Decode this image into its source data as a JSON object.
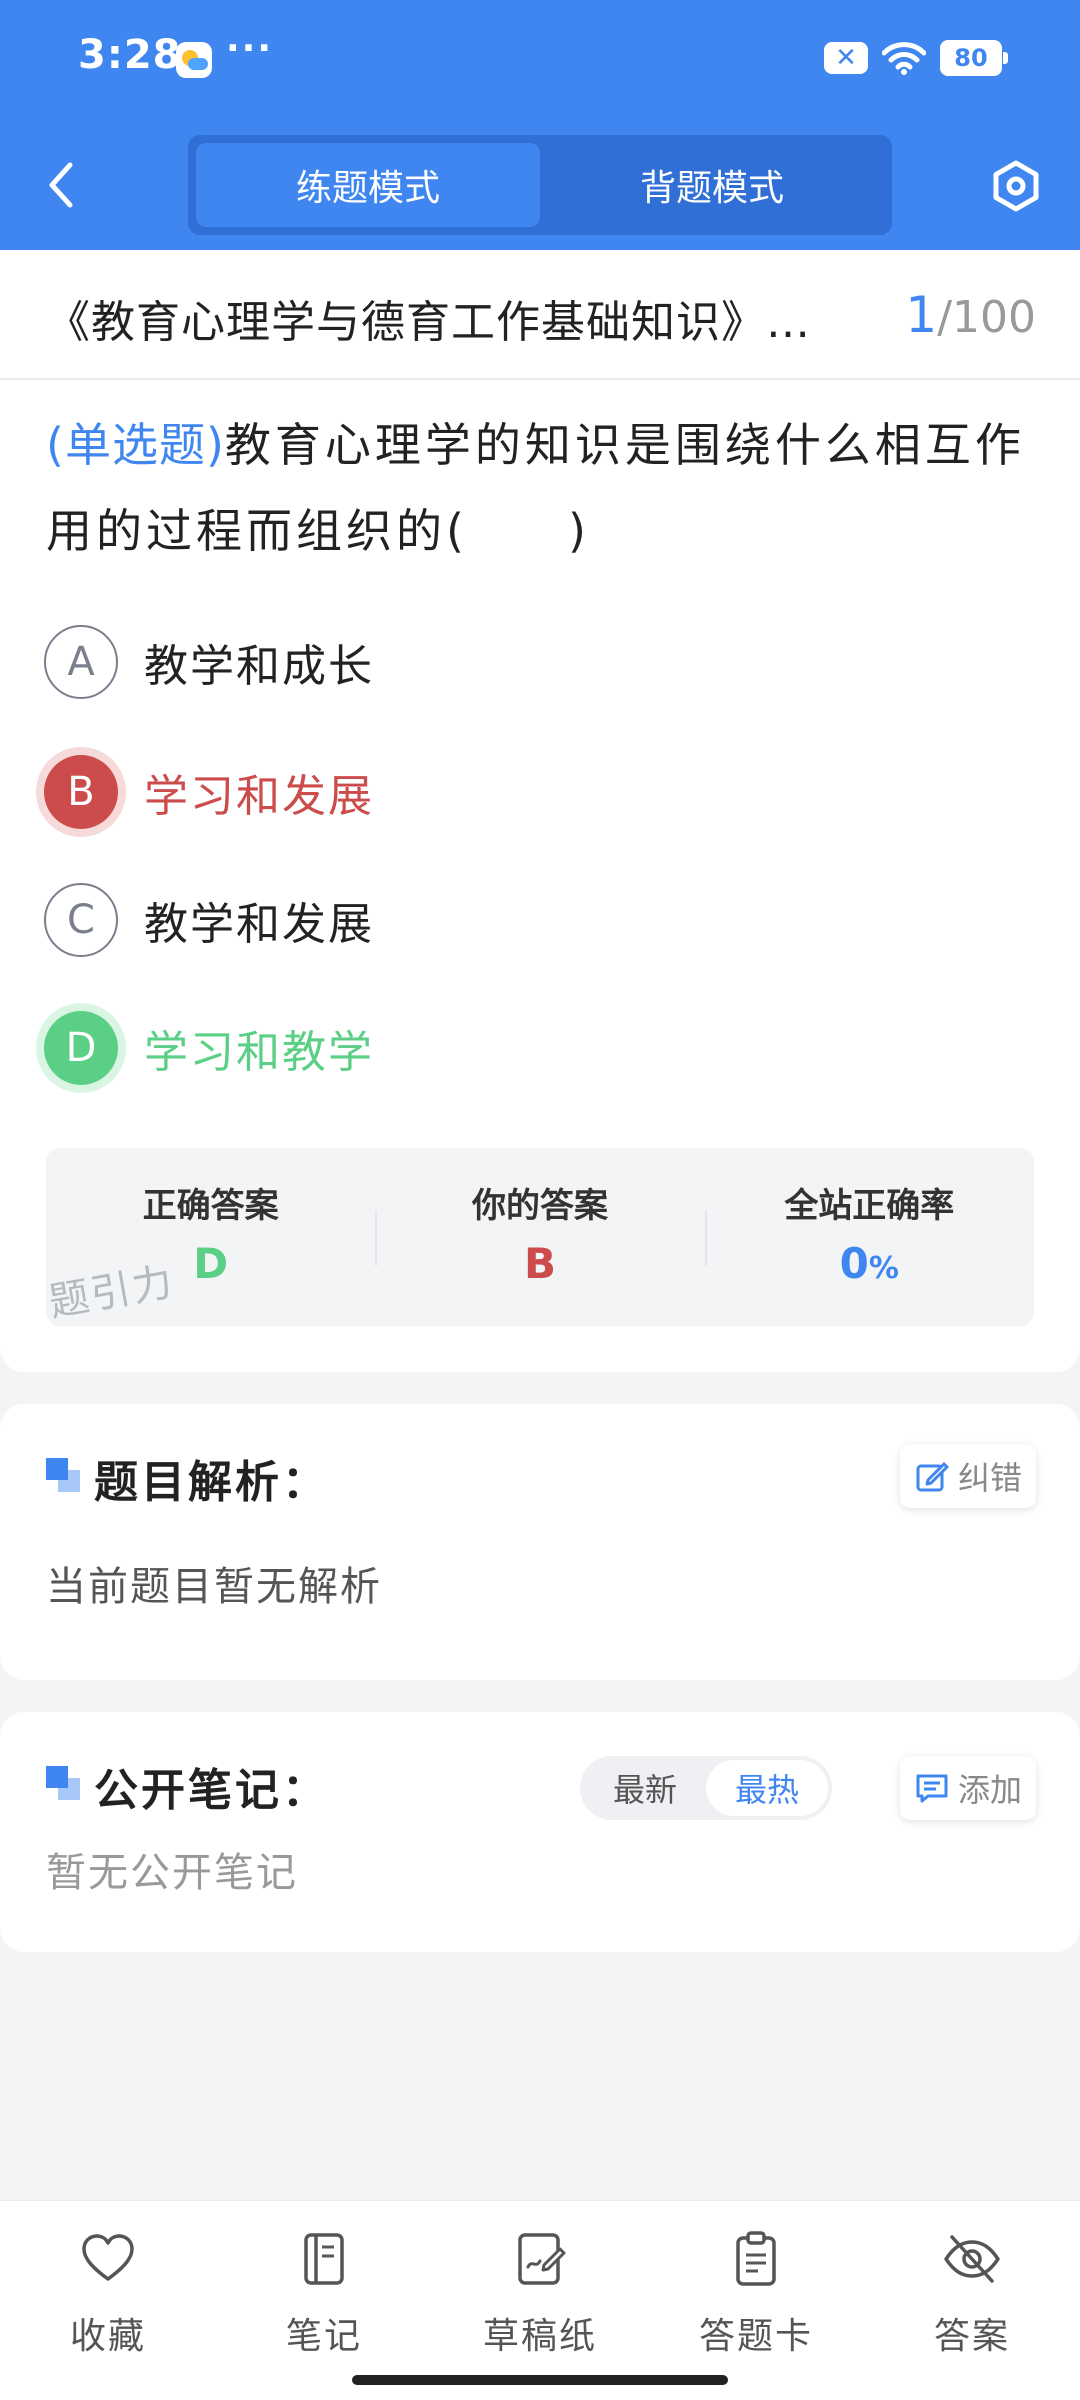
{
  "status_bar": {
    "time": "3:28",
    "dots": "···",
    "sim_badge": "✕",
    "battery": "80"
  },
  "header": {
    "modes": [
      "练题模式",
      "背题模式"
    ],
    "active_mode": 0
  },
  "title_bar": {
    "title": "《教育心理学与德育工作基础知识》…",
    "current": "1",
    "total": "/100"
  },
  "question": {
    "type": "(单选题)",
    "text": "教育心理学的知识是围绕什么相互作用的过程而组织的(　　)",
    "options": [
      {
        "letter": "A",
        "text": "教学和成长",
        "state": "normal"
      },
      {
        "letter": "B",
        "text": "学习和发展",
        "state": "wrong"
      },
      {
        "letter": "C",
        "text": "教学和发展",
        "state": "normal"
      },
      {
        "letter": "D",
        "text": "学习和教学",
        "state": "correct"
      }
    ]
  },
  "answer_summary": {
    "correct_label": "正确答案",
    "correct_value": "D",
    "yours_label": "你的答案",
    "yours_value": "B",
    "rate_label": "全站正确率",
    "rate_value": "0",
    "rate_unit": "%",
    "watermark": "题引力"
  },
  "analysis": {
    "title": "题目解析：",
    "body": "当前题目暂无解析",
    "report_label": "纠错"
  },
  "notes": {
    "title": "公开笔记：",
    "sort_options": [
      "最新",
      "最热"
    ],
    "active_sort": 1,
    "add_label": "添加",
    "empty_text": "暂无公开笔记"
  },
  "bottom_tabs": [
    {
      "label": "收藏",
      "icon": "heart-icon"
    },
    {
      "label": "笔记",
      "icon": "notebook-icon"
    },
    {
      "label": "草稿纸",
      "icon": "draft-icon"
    },
    {
      "label": "答题卡",
      "icon": "clipboard-icon"
    },
    {
      "label": "答案",
      "icon": "eye-off-icon"
    }
  ],
  "colors": {
    "primary": "#3f86f0",
    "correct": "#5ccf86",
    "wrong": "#cc4b4b",
    "background": "#f3f4f6"
  }
}
